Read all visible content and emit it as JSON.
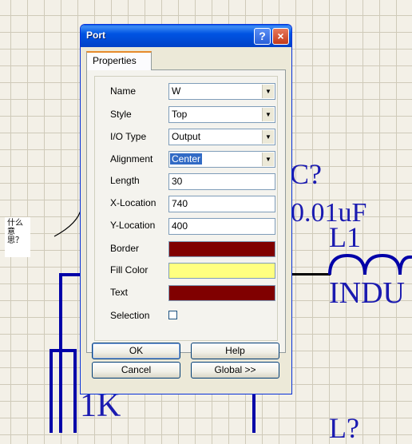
{
  "dialog": {
    "title": "Port",
    "help_icon": "?",
    "close_icon": "×",
    "tab": "Properties",
    "fields": {
      "name": {
        "label": "Name",
        "value": "W"
      },
      "style": {
        "label": "Style",
        "value": "Top"
      },
      "io_type": {
        "label": "I/O Type",
        "value": "Output"
      },
      "alignment": {
        "label": "Alignment",
        "value": "Center"
      },
      "length": {
        "label": "Length",
        "value": "30"
      },
      "x_location": {
        "label": "X-Location",
        "value": "740"
      },
      "y_location": {
        "label": "Y-Location",
        "value": "400"
      },
      "border": {
        "label": "Border",
        "color": "#800000"
      },
      "fill_color": {
        "label": "Fill Color",
        "color": "#ffff80"
      },
      "text": {
        "label": "Text",
        "color": "#800000"
      },
      "selection": {
        "label": "Selection",
        "checked": false
      }
    },
    "buttons": {
      "ok": "OK",
      "help": "Help",
      "cancel": "Cancel",
      "global": "Global >>"
    }
  },
  "schematic": {
    "labels": {
      "cap_ref": "C?",
      "cap_value": "0.01uF",
      "ind_ref": "L1",
      "ind_value": "INDU",
      "resistor_value": "1K",
      "next_ref": "L?"
    },
    "annotation": "什么意思？"
  },
  "colors": {
    "wire_blue": "#0000a8",
    "wire_black": "#000000",
    "text_blue": "#1a1ab0",
    "title_blue": "#0054e3"
  }
}
